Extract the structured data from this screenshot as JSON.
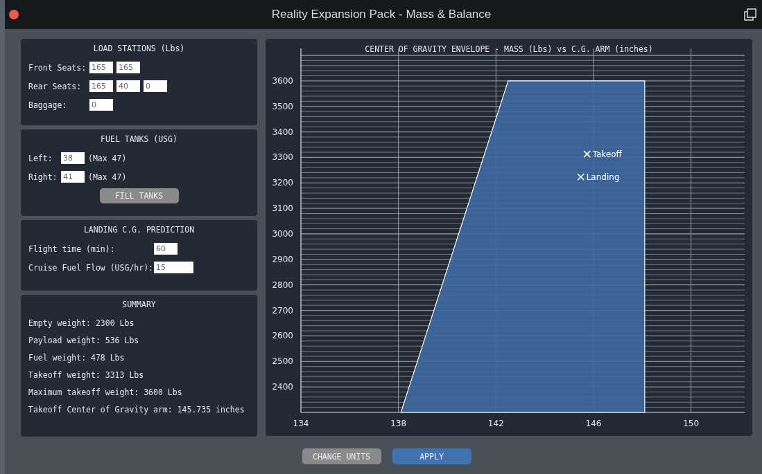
{
  "window": {
    "title": "Reality Expansion Pack - Mass & Balance"
  },
  "load_stations": {
    "title": "LOAD STATIONS (Lbs)",
    "rows": [
      {
        "label": "Front Seats:",
        "values": [
          "165",
          "165"
        ]
      },
      {
        "label": "Rear Seats:",
        "values": [
          "165",
          "40",
          "0"
        ]
      },
      {
        "label": "Baggage:",
        "values": [
          "0"
        ]
      }
    ]
  },
  "fuel_tanks": {
    "title": "FUEL TANKS (USG)",
    "rows": [
      {
        "label": "Left:",
        "value": "38",
        "note": "(Max 47)"
      },
      {
        "label": "Right:",
        "value": "41",
        "note": "(Max 47)"
      }
    ],
    "button": "FILL TANKS"
  },
  "landing_prediction": {
    "title": "LANDING C.G. PREDICTION",
    "rows": [
      {
        "label": "Flight time (min):",
        "value": "60"
      },
      {
        "label": "Cruise Fuel Flow (USG/hr):",
        "value": "15"
      }
    ]
  },
  "summary": {
    "title": "SUMMARY",
    "lines": [
      "Empty weight: 2300 Lbs",
      "Payload weight: 536 Lbs",
      "Fuel weight: 478 Lbs",
      "Takeoff weight: 3313 Lbs",
      "Maximum takeoff weight: 3600 Lbs",
      "Takeoff Center of Gravity arm: 145.735 inches"
    ]
  },
  "chart": {
    "chart_data": {
      "type": "area",
      "title": "CENTER OF GRAVITY ENVELOPE - MASS (Lbs) vs C.G. ARM (inches)",
      "x": [
        138.1,
        142.5,
        148.1
      ],
      "series": [
        {
          "color": "#3f68a0",
          "values": [
            2300,
            3600,
            3600
          ]
        }
      ],
      "grid": true,
      "xlim": [
        134,
        152.2
      ],
      "ylim": [
        2300,
        3700
      ],
      "xticks": [
        134,
        138,
        142,
        146,
        150
      ],
      "yticks": [
        2400,
        2500,
        2600,
        2700,
        2800,
        2900,
        3000,
        3100,
        3200,
        3300,
        3400,
        3500,
        3600
      ],
      "annotations": [
        "Takeoff",
        "Landing"
      ]
    }
  },
  "buttons": [
    {
      "label": "CHANGE UNITS",
      "kind": "secondary"
    },
    {
      "label": "APPLY",
      "kind": "primary"
    }
  ]
}
